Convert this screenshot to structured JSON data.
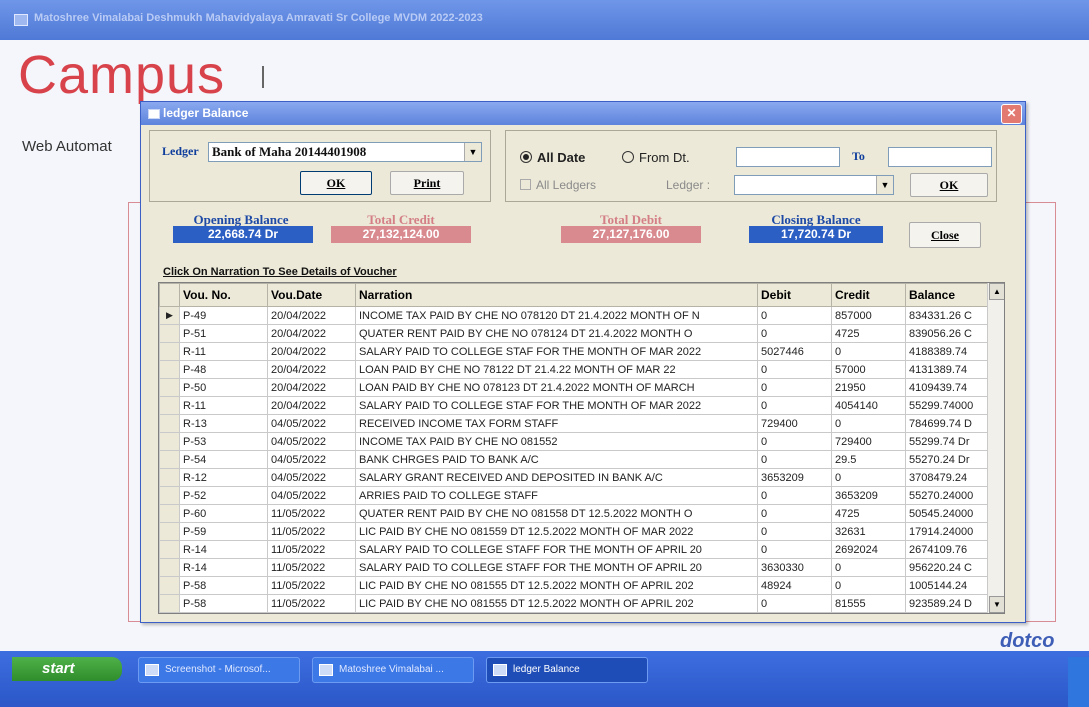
{
  "window": {
    "title": "Matoshree Vimalabai Deshmukh Mahavidyalaya Amravati Sr College MVDM 2022-2023"
  },
  "background": {
    "brand": "Campus",
    "web_text": "Web Automat",
    "logo_text": "dotco"
  },
  "dialog": {
    "title": "ledger Balance",
    "ledger_label": "Ledger",
    "ledger_value": "Bank of Maha 20144401908",
    "ok_label": "OK",
    "print_label": "Print",
    "all_date_label": "All Date",
    "all_date_selected": true,
    "from_dt_label": "From Dt.",
    "to_label": "To",
    "all_ledgers_label": "All Ledgers",
    "ledger2_label": "Ledger :",
    "ok2_label": "OK",
    "close_label": "Close",
    "opening_balance_label": "Opening Balance",
    "opening_balance_value": "22,668.74 Dr",
    "total_credit_label": "Total Credit",
    "total_credit_value": "27,132,124.00",
    "total_debit_label": "Total Debit",
    "total_debit_value": "27,127,176.00",
    "closing_balance_label": "Closing Balance",
    "closing_balance_value": "17,720.74 Dr",
    "narration_link": "Click On Narration To See Details of Voucher",
    "colors": {
      "opening": "#2c5fc4",
      "credit": "#d98a8f",
      "debit": "#d98a8f",
      "closing": "#2c5fc4"
    }
  },
  "grid": {
    "columns": [
      "Vou. No.",
      "Vou.Date",
      "Narration",
      "Debit",
      "Credit",
      "Balance"
    ],
    "rows": [
      [
        "P-49",
        "20/04/2022",
        "INCOME TAX PAID BY CHE NO 078120 DT 21.4.2022 MONTH OF N",
        "0",
        "857000",
        "834331.26 C"
      ],
      [
        "P-51",
        "20/04/2022",
        "QUATER RENT PAID BY CHE NO 078124 DT 21.4.2022 MONTH O",
        "0",
        "4725",
        "839056.26 C"
      ],
      [
        "R-11",
        "20/04/2022",
        "SALARY PAID TO COLLEGE STAF FOR THE MONTH OF MAR 2022",
        "5027446",
        "0",
        "4188389.74"
      ],
      [
        "P-48",
        "20/04/2022",
        "LOAN PAID BY CHE NO 78122 DT 21.4.22 MONTH OF MAR 22",
        "0",
        "57000",
        "4131389.74"
      ],
      [
        "P-50",
        "20/04/2022",
        "LOAN PAID BY CHE NO 078123 DT 21.4.2022 MONTH OF MARCH",
        "0",
        "21950",
        "4109439.74"
      ],
      [
        "R-11",
        "20/04/2022",
        "SALARY PAID TO COLLEGE STAF FOR THE MONTH OF MAR 2022",
        "0",
        "4054140",
        "55299.74000"
      ],
      [
        "R-13",
        "04/05/2022",
        "RECEIVED INCOME TAX FORM STAFF",
        "729400",
        "0",
        "784699.74 D"
      ],
      [
        "P-53",
        "04/05/2022",
        "INCOME TAX PAID BY CHE NO 081552",
        "0",
        "729400",
        "55299.74 Dr"
      ],
      [
        "P-54",
        "04/05/2022",
        "BANK CHRGES PAID TO BANK A/C",
        "0",
        "29.5",
        "55270.24 Dr"
      ],
      [
        "R-12",
        "04/05/2022",
        "SALARY GRANT RECEIVED AND DEPOSITED IN BANK A/C",
        "3653209",
        "0",
        "3708479.24"
      ],
      [
        "P-52",
        "04/05/2022",
        "ARRIES PAID TO COLLEGE STAFF",
        "0",
        "3653209",
        "55270.24000"
      ],
      [
        "P-60",
        "11/05/2022",
        "QUATER RENT PAID BY CHE NO 081558 DT 12.5.2022 MONTH O",
        "0",
        "4725",
        "50545.24000"
      ],
      [
        "P-59",
        "11/05/2022",
        "LIC PAID BY CHE NO 081559 DT 12.5.2022 MONTH OF MAR 2022",
        "0",
        "32631",
        "17914.24000"
      ],
      [
        "R-14",
        "11/05/2022",
        "SALARY PAID TO COLLEGE STAFF FOR THE MONTH OF APRIL 20",
        "0",
        "2692024",
        "2674109.76"
      ],
      [
        "R-14",
        "11/05/2022",
        "SALARY PAID TO COLLEGE STAFF FOR THE MONTH OF APRIL 20",
        "3630330",
        "0",
        "956220.24 C"
      ],
      [
        "P-58",
        "11/05/2022",
        "LIC PAID BY CHE NO 081555 DT 12.5.2022 MONTH OF APRIL 202",
        "48924",
        "0",
        "1005144.24"
      ],
      [
        "P-58",
        "11/05/2022",
        "LIC PAID BY CHE NO 081555 DT 12.5.2022 MONTH OF APRIL 202",
        "0",
        "81555",
        "923589.24 D"
      ]
    ]
  },
  "taskbar": {
    "start_label": "start",
    "items": [
      "Screenshot - Microsof...",
      "Matoshree Vimalabai ...",
      "ledger Balance"
    ]
  }
}
